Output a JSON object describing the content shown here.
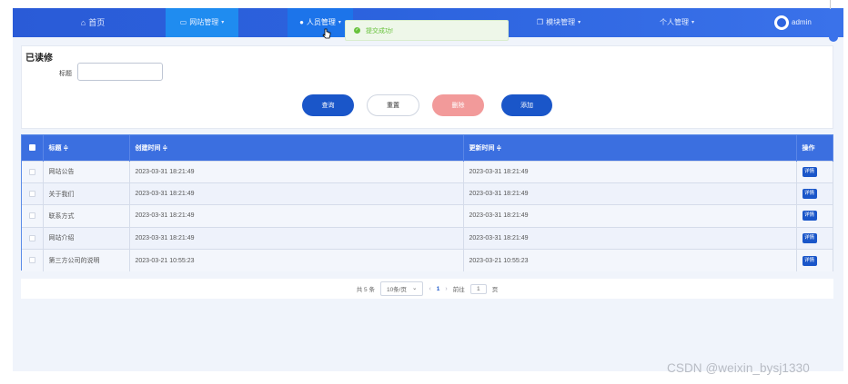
{
  "nav": {
    "home": "首页",
    "website": "网站管理",
    "staff": "人员管理",
    "module": "模块管理",
    "personal": "个人管理",
    "user": "admin"
  },
  "toast": {
    "message": "提交成功!"
  },
  "search": {
    "title": "已读修",
    "label": "标题",
    "input_value": "",
    "buttons": {
      "query": "查询",
      "reset": "重置",
      "delete": "删除",
      "add": "添加"
    }
  },
  "table": {
    "headers": {
      "title": "标题 ≑",
      "created": "创建时间 ≑",
      "updated": "更新时间 ≑",
      "actions": "操作"
    },
    "detail_label": "详情",
    "rows": [
      {
        "title": "网站公告",
        "created": "2023-03-31 18:21:49",
        "updated": "2023-03-31 18:21:49"
      },
      {
        "title": "关于我们",
        "created": "2023-03-31 18:21:49",
        "updated": "2023-03-31 18:21:49"
      },
      {
        "title": "联系方式",
        "created": "2023-03-31 18:21:49",
        "updated": "2023-03-31 18:21:49"
      },
      {
        "title": "网站介绍",
        "created": "2023-03-31 18:21:49",
        "updated": "2023-03-31 18:21:49"
      },
      {
        "title": "第三方公司的说明",
        "created": "2023-03-21 10:55:23",
        "updated": "2023-03-21 10:55:23"
      }
    ]
  },
  "pager": {
    "total": "共 5 条",
    "page_size": "10条/页",
    "current": "1",
    "goto_prefix": "前往",
    "goto_value": "1",
    "goto_suffix": "页"
  },
  "watermark": "CSDN @weixin_bysj1330",
  "colors": {
    "nav_bg": "#2c63de",
    "primary": "#1a56c9",
    "danger_light": "#f29a9a",
    "success": "#67c23a"
  }
}
